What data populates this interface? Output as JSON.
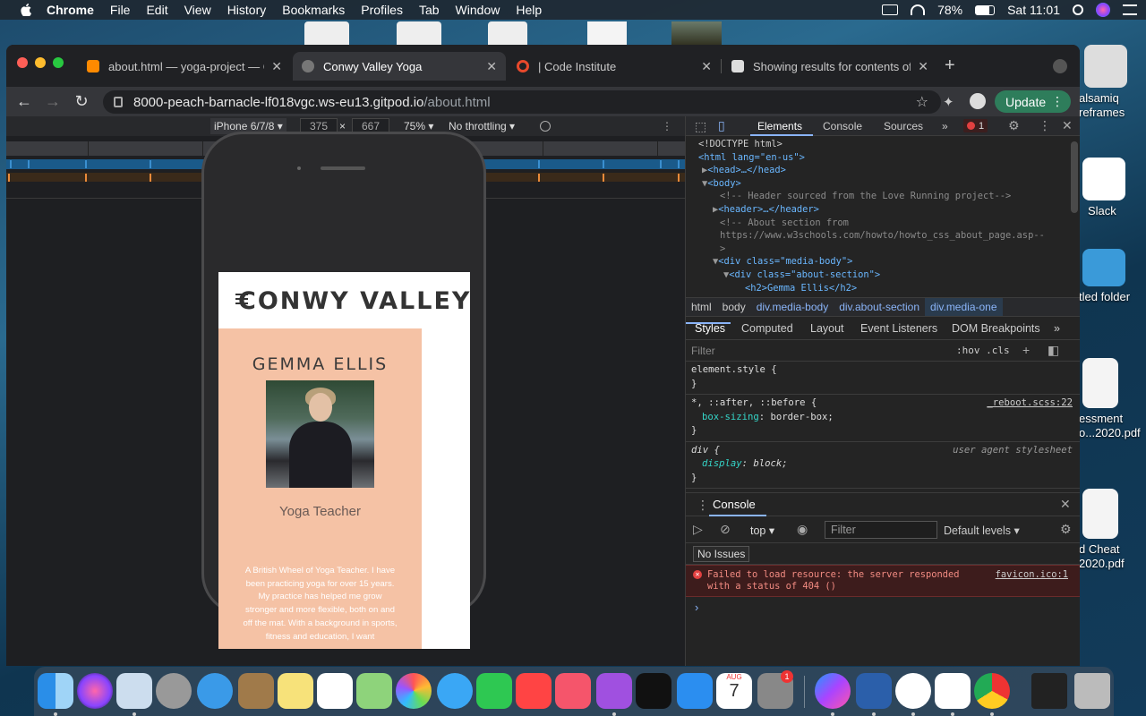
{
  "menubar": {
    "app": "Chrome",
    "items": [
      "File",
      "Edit",
      "View",
      "History",
      "Bookmarks",
      "Profiles",
      "Tab",
      "Window",
      "Help"
    ],
    "battery": "78%",
    "clock": "Sat 11:01"
  },
  "desktop": {
    "items": [
      "alsamiq\nreframes",
      "Slack",
      "tled folder",
      "essment\no...2020.pdf",
      "d Cheat\n2020.pdf"
    ]
  },
  "browser": {
    "tabs": [
      {
        "title": "about.html — yoga-project — G",
        "active": false
      },
      {
        "title": "Conwy Valley Yoga",
        "active": true
      },
      {
        "title": "| Code Institute",
        "active": false
      },
      {
        "title": "Showing results for contents of",
        "active": false
      }
    ],
    "url_host": "8000-peach-barnacle-lf018vgc.ws-eu13.gitpod.io",
    "url_path": "/about.html",
    "update_label": "Update"
  },
  "device_toolbar": {
    "device": "iPhone 6/7/8 ▾",
    "width": "375",
    "height": "667",
    "times": "×",
    "zoom": "75% ▾",
    "throttling": "No throttling ▾"
  },
  "site": {
    "logo": "CONWY VALLEY Y",
    "name": "GEMMA ELLIS",
    "role": "Yoga Teacher",
    "bio": "A British Wheel of Yoga Teacher. I have been practicing yoga for over 15 years. My practice has helped me grow stronger and more flexible, both on and off the mat. With a background in sports, fitness and education, I want"
  },
  "devtools": {
    "tabs": [
      "Elements",
      "Console",
      "Sources",
      "»"
    ],
    "error_count": "1",
    "dom": {
      "doctype": "<!DOCTYPE html>",
      "html_open": "<html lang=\"en-us\">",
      "head": "<head>…</head>",
      "body_open": "<body>",
      "comment1": "<!-- Header sourced from the Love Running project-->",
      "header": "<header>…</header>",
      "comment2a": "<!-- About section from",
      "comment2b": "https://www.w3schools.com/howto/howto_css_about_page.asp--",
      "comment2c": ">",
      "div1": "<div class=\"media-body\">",
      "div2": "<div class=\"about-section\">",
      "h2_partial": "<h2>Gemma Ellis</h2>"
    },
    "breadcrumbs": [
      "html",
      "body",
      "div.media-body",
      "div.about-section",
      "div.media-one"
    ],
    "style_tabs": [
      "Styles",
      "Computed",
      "Layout",
      "Event Listeners",
      "DOM Breakpoints",
      "»"
    ],
    "filter_placeholder": "Filter",
    "hov_cls": ":hov  .cls",
    "rules": [
      {
        "selector": "element.style {",
        "close": "}"
      },
      {
        "selector": "*, ::after, ::before {",
        "prop": "box-sizing",
        "value": "border-box;",
        "source": "_reboot.scss:22",
        "close": "}"
      },
      {
        "selector": "div {",
        "prop": "display",
        "value": "block;",
        "source": "user agent stylesheet",
        "close": "}"
      }
    ],
    "console": {
      "title": "Console",
      "context": "top ▾",
      "filter_placeholder": "Filter",
      "levels": "Default levels ▾",
      "no_issues": "No Issues",
      "error_line1": "Failed to load resource: the server responded",
      "error_line2": "with a status of 404 ()",
      "error_source": "favicon.ico:1",
      "prompt": "›"
    }
  },
  "dock": {
    "calendar_month": "AUG",
    "calendar_day": "7",
    "settings_badge": "1"
  },
  "colors": {
    "accent_blue": "#8ab4f8",
    "about_bg": "#f5c2a5",
    "error_red": "#e24040"
  }
}
